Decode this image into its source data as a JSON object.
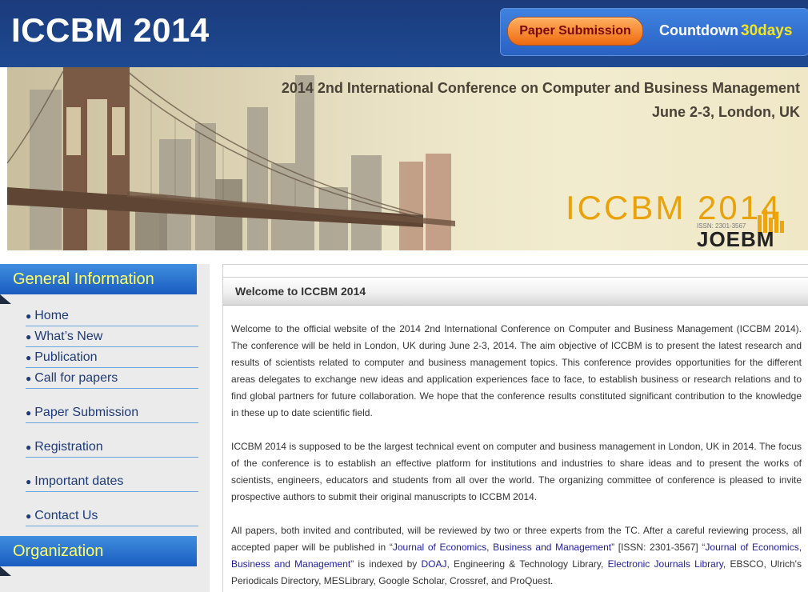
{
  "header": {
    "title": "ICCBM 2014",
    "paper_submission_label": "Paper Submission",
    "countdown_label": "Countdown",
    "countdown_value": "30days"
  },
  "banner": {
    "line1": "2014 2nd International Conference on Computer and Business Management",
    "line2": "June 2-3, London, UK",
    "logo_text": "ICCBM 2014",
    "issn": "ISSN: 2301-3567",
    "journal_logo": "JOEBM"
  },
  "sidebar": {
    "general_heading": "General Information",
    "items": [
      {
        "label": "Home"
      },
      {
        "label": "What’s New"
      },
      {
        "label": "Publication"
      },
      {
        "label": "Call for papers"
      },
      {
        "label": "Paper Submission"
      },
      {
        "label": "Registration"
      },
      {
        "label": "Important dates"
      },
      {
        "label": "Contact Us"
      }
    ],
    "organization_heading": "Organization"
  },
  "main": {
    "title": "Welcome to ICCBM 2014",
    "p1": "Welcome to the official website of the 2014 2nd International Conference on Computer and Business Management (ICCBM 2014). The conference will be held in London, UK during June 2-3, 2014. The aim objective of ICCBM is to present the latest research and results of scientists related to computer and business management topics. This conference provides opportunities for the different areas delegates to exchange new ideas and application experiences face to face, to establish business or research relations and to find global partners for future collaboration. We hope that the conference results constituted significant contribution to the knowledge in these up to date scientific field.",
    "p2": "ICCBM 2014 is supposed to be the largest technical event on computer and business management in  London, UK  in 2014. The focus of the conference is to establish an effective platform for institutions and industries to share ideas and to present the works of scientists, engineers, educators and students from all over the world. The organizing committee of conference is pleased to invite prospective authors to submit their original manuscripts to ICCBM 2014.",
    "p3": {
      "t1": "All papers, both invited and contributed, will be reviewed by two or three experts from the TC. After a careful reviewing process, all accepted paper will be published in  “",
      "link1": "Journal of Economics, Business and Management",
      "t2": "” [ISSN: 2301-3567] “",
      "link2": "Journal of Economics, Business and Management",
      "t3": "” is indexed by ",
      "link3": "DOAJ",
      "t4": ", Engineering & Technology Library,  ",
      "link4": "Electronic Journals Library",
      "t5": ", EBSCO, Ulrich's Periodicals Directory, MESLibrary, Google Scholar, Crossref, and ProQuest."
    }
  }
}
